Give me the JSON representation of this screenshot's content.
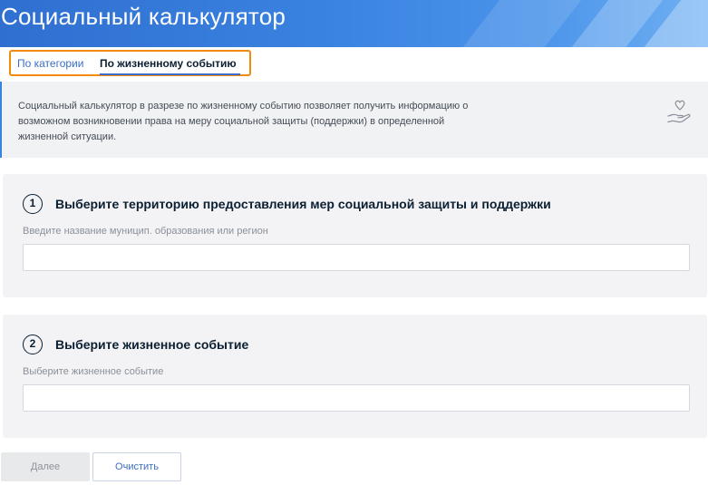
{
  "header": {
    "title": "Социальный калькулятор"
  },
  "tabs": [
    {
      "label": "По категории",
      "active": false
    },
    {
      "label": "По жизненному событию",
      "active": true
    }
  ],
  "info": {
    "text": "Социальный калькулятор в разрезе по жизненному событию позволяет получить информацию о возможном возникновении права на меру социальной защиты (поддержки) в определенной жизненной ситуации.",
    "icon": "heart-hand-icon"
  },
  "steps": [
    {
      "number": "1",
      "title": "Выберите территорию предоставления мер социальной защиты и поддержки",
      "label": "Введите название муницип. образования или регион",
      "value": ""
    },
    {
      "number": "2",
      "title": "Выберите жизненное событие",
      "label": "Выберите жизненное событие",
      "value": ""
    }
  ],
  "buttons": {
    "next_label": "Далее",
    "clear_label": "Очистить"
  },
  "colors": {
    "accent": "#3a6ec7",
    "highlight": "#f28a12",
    "banner": "#3a82e0"
  }
}
